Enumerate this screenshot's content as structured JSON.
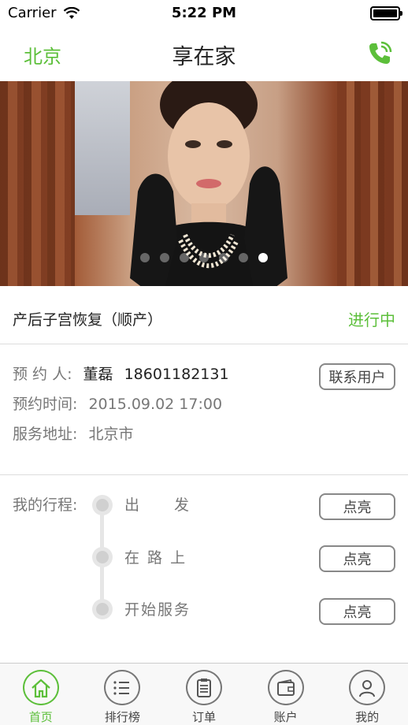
{
  "status_bar": {
    "carrier": "Carrier",
    "time": "5:22 PM"
  },
  "nav": {
    "city": "北京",
    "title": "享在家",
    "phone_icon": "phone-call-icon"
  },
  "banner": {
    "slide_count": 7,
    "active_slide": 6
  },
  "service": {
    "name": "产后子宫恢复（顺产）",
    "status": "进行中"
  },
  "details": {
    "booker_label": "预 约 人:",
    "booker_name": "董磊",
    "booker_phone": "18601182131",
    "contact_button": "联系用户",
    "time_label": "预约时间:",
    "time_value": "2015.09.02 17:00",
    "address_label": "服务地址:",
    "address_value": "北京市"
  },
  "trip": {
    "label": "我的行程:",
    "steps": [
      {
        "text": "出　　发",
        "button": "点亮"
      },
      {
        "text": "在 路 上",
        "button": "点亮"
      },
      {
        "text": "开始服务",
        "button": "点亮"
      }
    ]
  },
  "tabbar": {
    "active": 0,
    "tabs": [
      {
        "label": "首页",
        "icon": "home-icon"
      },
      {
        "label": "排行榜",
        "icon": "list-icon"
      },
      {
        "label": "订单",
        "icon": "clipboard-icon"
      },
      {
        "label": "账户",
        "icon": "wallet-icon"
      },
      {
        "label": "我的",
        "icon": "user-icon"
      }
    ]
  },
  "colors": {
    "accent": "#5cbf3a",
    "text": "#222222",
    "muted": "#777777",
    "border": "#dddddd"
  }
}
